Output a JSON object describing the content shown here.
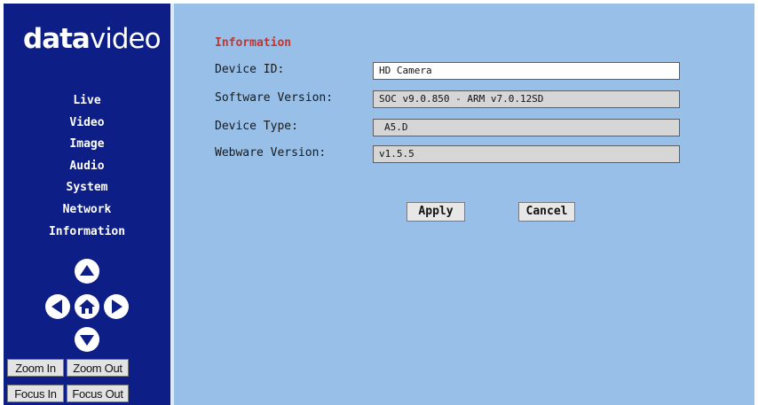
{
  "sidebar": {
    "logo": {
      "brand_bold": "data",
      "brand_thin": "video"
    },
    "nav": [
      {
        "label": "Live"
      },
      {
        "label": "Video"
      },
      {
        "label": "Image"
      },
      {
        "label": "Audio"
      },
      {
        "label": "System"
      },
      {
        "label": "Network"
      },
      {
        "label": "Information"
      }
    ],
    "ptz": {
      "up_icon": "triangle-up-icon",
      "left_icon": "triangle-left-icon",
      "home_icon": "home-icon",
      "right_icon": "triangle-right-icon",
      "down_icon": "triangle-down-icon"
    },
    "zoom": {
      "zoom_in": "Zoom In",
      "zoom_out": "Zoom Out"
    },
    "focus": {
      "focus_in": "Focus In",
      "focus_out": "Focus Out"
    }
  },
  "main": {
    "title": "Information",
    "fields": [
      {
        "label": "Device ID:",
        "value": "HD Camera",
        "editable": true
      },
      {
        "label": "Software Version:",
        "value": "SOC v9.0.850 - ARM v7.0.12SD",
        "editable": false
      },
      {
        "label": "Device Type:",
        "value": "A5.D",
        "editable": false
      },
      {
        "label": "Webware Version:",
        "value": "v1.5.5",
        "editable": false
      }
    ],
    "buttons": {
      "apply": "Apply",
      "cancel": "Cancel"
    }
  },
  "colors": {
    "sidebar_bg": "#0d1f86",
    "main_bg": "#97bfe7",
    "title_red": "#c8332d",
    "readonly_field": "#d6d6d6"
  }
}
